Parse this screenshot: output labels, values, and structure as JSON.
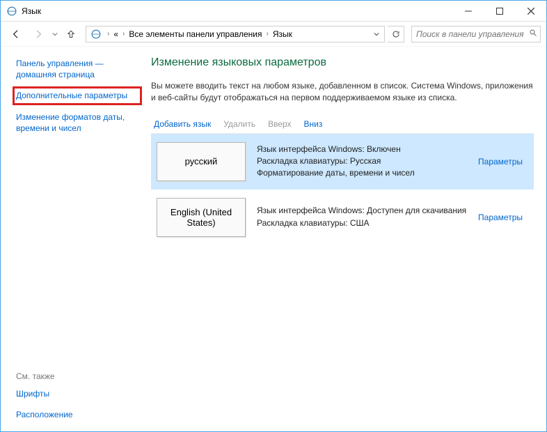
{
  "window": {
    "title": "Язык"
  },
  "breadcrumb": {
    "ellipsis": "«",
    "root": "Все элементы панели управления",
    "leaf": "Язык"
  },
  "search": {
    "placeholder": "Поиск в панели управления"
  },
  "sidebar": {
    "home": "Панель управления — домашняя страница",
    "advanced": "Дополнительные параметры",
    "formats": "Изменение форматов даты, времени и чисел",
    "see_also": "См. также",
    "fonts": "Шрифты",
    "location": "Расположение"
  },
  "main": {
    "heading": "Изменение языковых параметров",
    "description": "Вы можете вводить текст на любом языке, добавленном в список. Система Windows, приложения и веб-сайты будут отображаться на первом поддерживаемом языке из списка."
  },
  "toolbar": {
    "add": "Добавить язык",
    "remove": "Удалить",
    "up": "Вверх",
    "down": "Вниз"
  },
  "languages": [
    {
      "name": "русский",
      "line1": "Язык интерфейса Windows: Включен",
      "line2": "Раскладка клавиатуры: Русская",
      "line3": "Форматирование даты, времени и чисел",
      "params": "Параметры",
      "selected": true
    },
    {
      "name": "English (United States)",
      "line1": "Язык интерфейса Windows: Доступен для скачивания",
      "line2": "Раскладка клавиатуры: США",
      "line3": "",
      "params": "Параметры",
      "selected": false
    }
  ]
}
